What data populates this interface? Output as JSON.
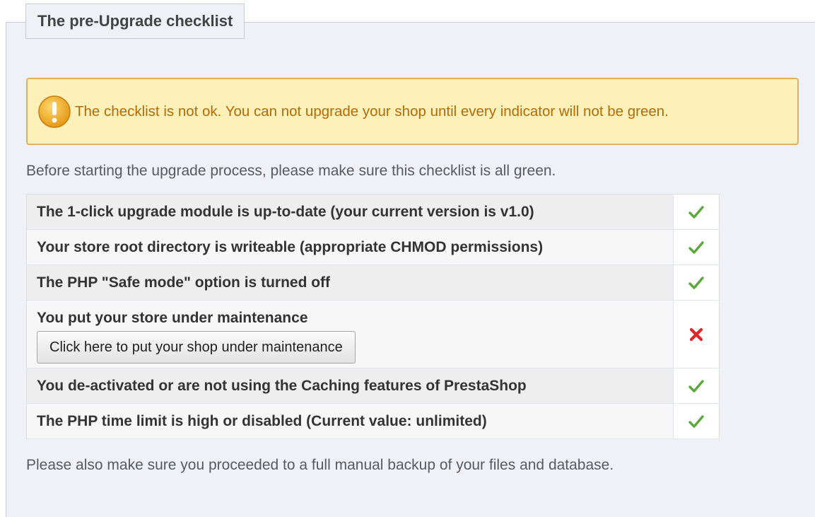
{
  "legend": "The pre-Upgrade checklist",
  "warning": {
    "icon": "warning-icon",
    "text": "The checklist is not ok. You can not upgrade your shop until every indicator will not be green.",
    "colors": {
      "background": "#fdf0b8",
      "border": "#e0b15a",
      "text": "#b36b08"
    }
  },
  "intro": "Before starting the upgrade process, please make sure this checklist is all green.",
  "checklist": [
    {
      "label": "The 1-click upgrade module is up-to-date (your current version is v1.0)",
      "status": "ok",
      "icon": "check-icon"
    },
    {
      "label": "Your store root directory is writeable (appropriate CHMOD permissions)",
      "status": "ok",
      "icon": "check-icon"
    },
    {
      "label": "The PHP \"Safe mode\" option is turned off",
      "status": "ok",
      "icon": "check-icon"
    },
    {
      "label": "You put your store under maintenance",
      "status": "fail",
      "icon": "cross-icon",
      "button": "Click here to put your shop under maintenance"
    },
    {
      "label": "You de-activated or are not using the Caching features of PrestaShop",
      "status": "ok",
      "icon": "check-icon"
    },
    {
      "label": "The PHP time limit is high or disabled (Current value: unlimited)",
      "status": "ok",
      "icon": "check-icon"
    }
  ],
  "outro": "Please also make sure you proceeded to a full manual backup of your files and database.",
  "colors": {
    "ok": "#5aa83a",
    "fail": "#e0252a",
    "panel": "#eff1f7"
  }
}
